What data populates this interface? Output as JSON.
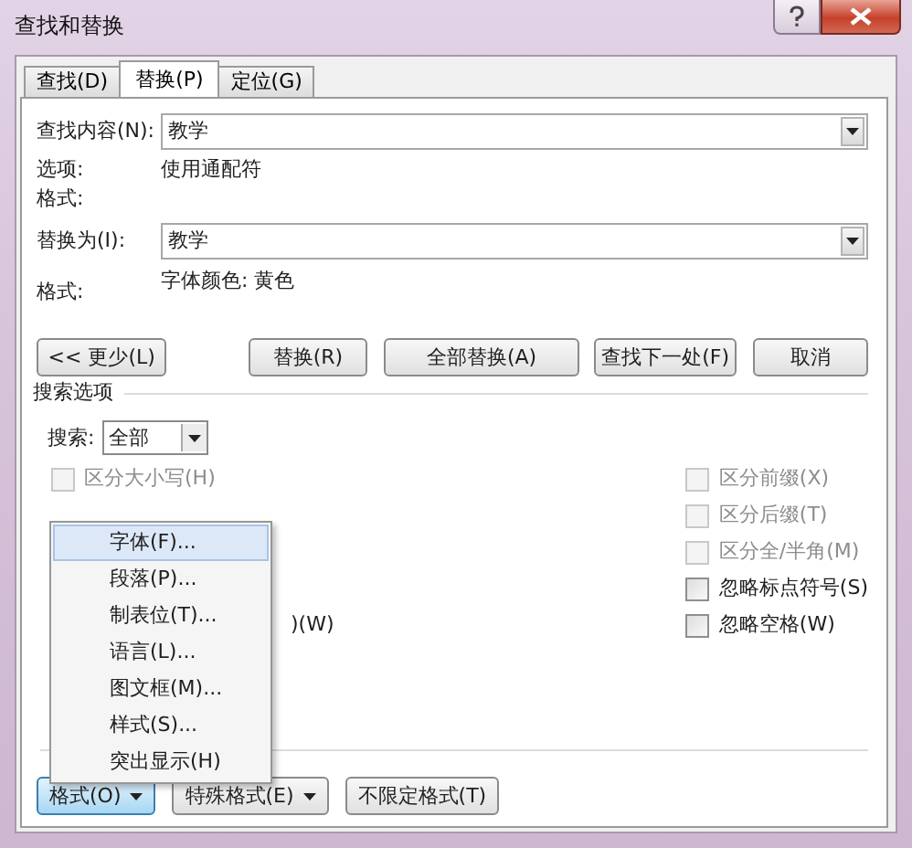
{
  "window": {
    "title": "查找和替换"
  },
  "tabs": [
    {
      "label": "查找(D)",
      "selected": false
    },
    {
      "label": "替换(P)",
      "selected": true
    },
    {
      "label": "定位(G)",
      "selected": false
    }
  ],
  "find": {
    "label": "查找内容(N):",
    "value": "教学"
  },
  "find_options": {
    "label": "选项:",
    "value": "使用通配符"
  },
  "find_format": {
    "label": "格式:"
  },
  "replace": {
    "label": "替换为(I):",
    "value": "教学"
  },
  "replace_format": {
    "label": "格式:",
    "value": "字体颜色: 黄色"
  },
  "buttons": [
    "<< 更少(L)",
    "替换(R)",
    "全部替换(A)",
    "查找下一处(F)",
    "取消"
  ],
  "search_options": {
    "title": "搜索选项",
    "search_label": "搜索:",
    "search_value": "全部"
  },
  "options_left": [
    {
      "label": "区分大小写(H)",
      "checked": false,
      "disabled": true
    }
  ],
  "options_left_partial": ")(W)",
  "options_right": [
    {
      "label": "区分前缀(X)",
      "checked": false,
      "disabled": true
    },
    {
      "label": "区分后缀(T)",
      "checked": false,
      "disabled": true
    },
    {
      "label": "区分全/半角(M)",
      "checked": false,
      "disabled": true
    },
    {
      "label": "忽略标点符号(S)",
      "checked": false,
      "disabled": false
    },
    {
      "label": "忽略空格(W)",
      "checked": false,
      "disabled": false
    }
  ],
  "bottom_buttons": [
    {
      "label": "格式(O)",
      "dropdown": true,
      "pressed": true
    },
    {
      "label": "特殊格式(E)",
      "dropdown": true,
      "pressed": false
    },
    {
      "label": "不限定格式(T)",
      "dropdown": false,
      "pressed": false
    }
  ],
  "menu": {
    "items": [
      {
        "label": "字体(F)...",
        "selected": true
      },
      {
        "label": "段落(P)...",
        "selected": false
      },
      {
        "label": "制表位(T)...",
        "selected": false
      },
      {
        "label": "语言(L)...",
        "selected": false
      },
      {
        "label": "图文框(M)...",
        "selected": false
      },
      {
        "label": "样式(S)...",
        "selected": false
      },
      {
        "label": "突出显示(H)",
        "selected": false
      }
    ]
  }
}
